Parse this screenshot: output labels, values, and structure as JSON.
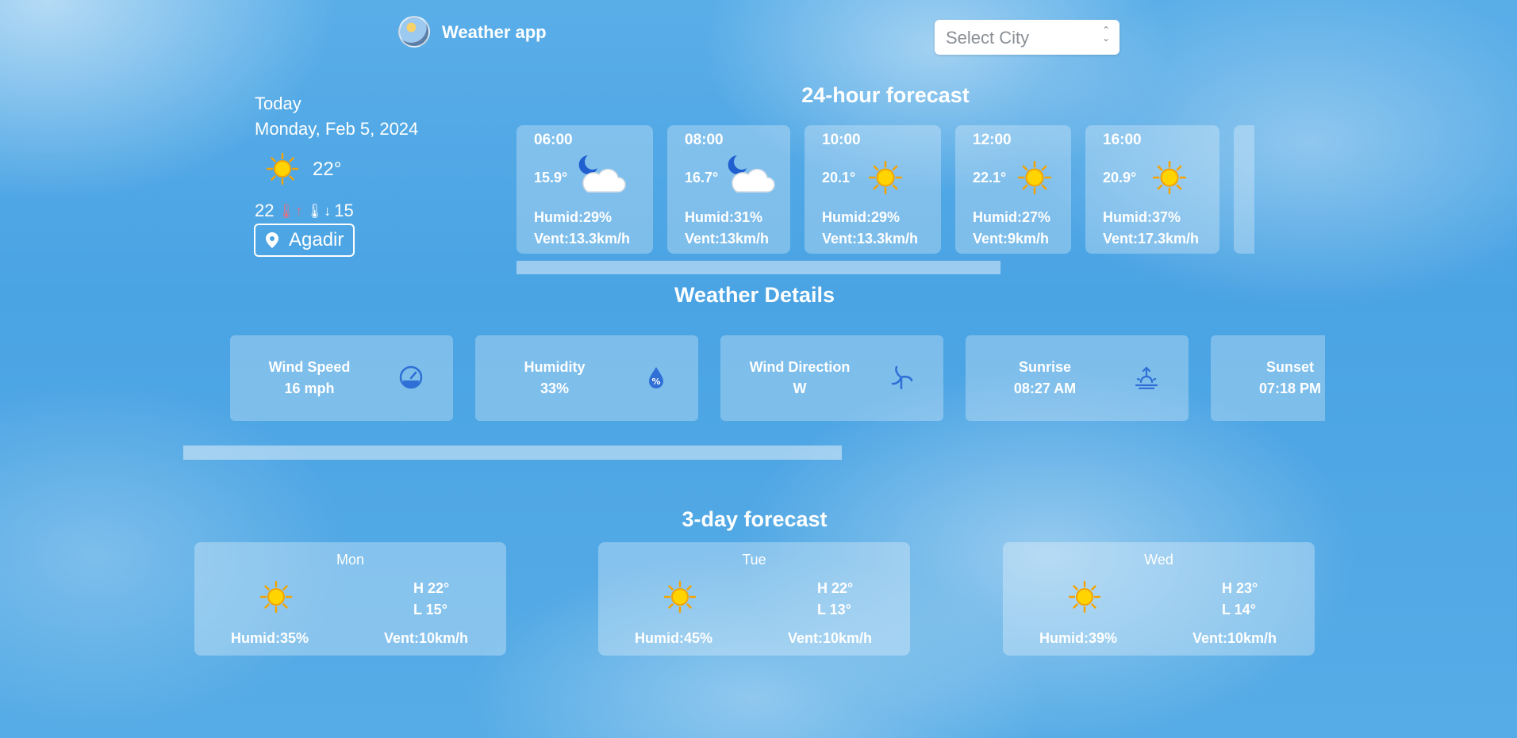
{
  "header": {
    "app_title": "Weather app",
    "city_select_placeholder": "Select City"
  },
  "today": {
    "label": "Today",
    "date": "Monday, Feb 5, 2024",
    "temp": "22°",
    "max": "22",
    "min": "15",
    "location": "Agadir",
    "icon": "sun-icon"
  },
  "hourly": {
    "title": "24-hour forecast",
    "items": [
      {
        "time": "06:00",
        "temp": "15.9°",
        "icon": "moon-cloud-icon",
        "humid": "Humid:29%",
        "wind": "Vent:13.3km/h"
      },
      {
        "time": "08:00",
        "temp": "16.7°",
        "icon": "moon-cloud-icon",
        "humid": "Humid:31%",
        "wind": "Vent:13km/h"
      },
      {
        "time": "10:00",
        "temp": "20.1°",
        "icon": "sun-icon",
        "humid": "Humid:29%",
        "wind": "Vent:13.3km/h"
      },
      {
        "time": "12:00",
        "temp": "22.1°",
        "icon": "sun-icon",
        "humid": "Humid:27%",
        "wind": "Vent:9km/h"
      },
      {
        "time": "16:00",
        "temp": "20.9°",
        "icon": "sun-icon",
        "humid": "Humid:37%",
        "wind": "Vent:17.3km/h"
      }
    ]
  },
  "details": {
    "title": "Weather Details",
    "items": [
      {
        "label": "Wind Speed",
        "value": "16 mph",
        "icon": "gauge-icon"
      },
      {
        "label": "Humidity",
        "value": "33%",
        "icon": "water-drop-percent-icon"
      },
      {
        "label": "Wind Direction",
        "value": "W",
        "icon": "wind-turbine-icon"
      },
      {
        "label": "Sunrise",
        "value": "08:27 AM",
        "icon": "sunrise-icon"
      },
      {
        "label": "Sunset",
        "value": "07:18 PM",
        "icon": "sunset-icon"
      }
    ]
  },
  "daily": {
    "title": "3-day forecast",
    "items": [
      {
        "day": "Mon",
        "high": "H 22°",
        "low": "L 15°",
        "humid": "Humid:35%",
        "wind": "Vent:10km/h",
        "icon": "sun-icon"
      },
      {
        "day": "Tue",
        "high": "H 22°",
        "low": "L 13°",
        "humid": "Humid:45%",
        "wind": "Vent:10km/h",
        "icon": "sun-icon"
      },
      {
        "day": "Wed",
        "high": "H 23°",
        "low": "L 14°",
        "humid": "Humid:39%",
        "wind": "Vent:10km/h",
        "icon": "sun-icon"
      }
    ]
  },
  "colors": {
    "accent_icon": "#2f6fd6",
    "sun_core": "#ffd400",
    "sun_ray": "#f5a300"
  }
}
